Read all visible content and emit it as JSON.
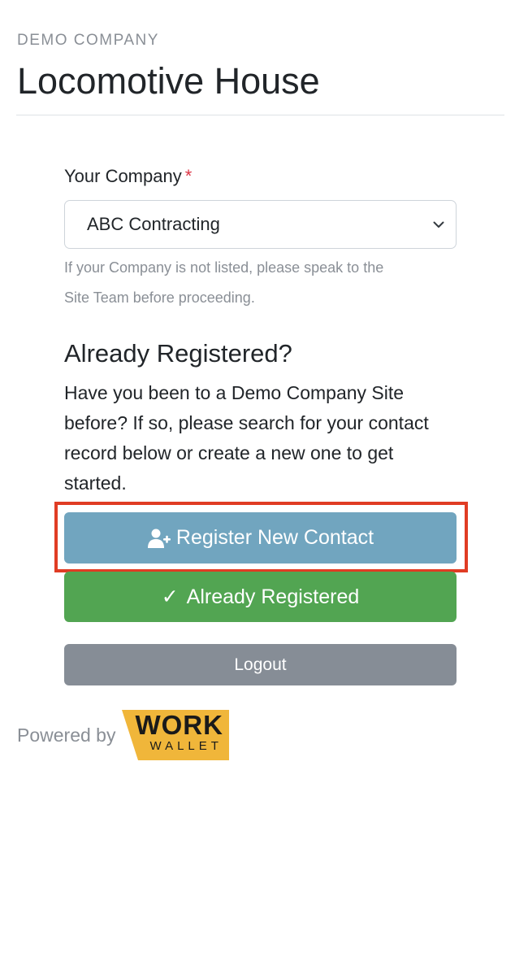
{
  "header": {
    "company": "DEMO COMPANY",
    "site_title": "Locomotive House"
  },
  "form": {
    "company_label": "Your Company",
    "required_mark": "*",
    "company_selected": "ABC Contracting",
    "help_line1": "If your Company is not listed, please speak to the",
    "help_line2": "Site Team before proceeding.",
    "section_heading": "Already Registered?",
    "body_lines": [
      "Have you been to a Demo Company Site",
      "before? If so, please search for your contact",
      "record below or create a new one to get",
      "started."
    ]
  },
  "buttons": {
    "register_label": "Register New Contact",
    "already_label": "Already Registered",
    "already_check": "✓",
    "logout_label": "Logout"
  },
  "footer": {
    "powered_by": "Powered by",
    "logo_line1": "WORK",
    "logo_line2": "WALLET"
  },
  "icons": {
    "register": "user-plus-icon",
    "select": "chevron-down-icon"
  },
  "colors": {
    "register_button": "#71a5bf",
    "already_button": "#52a552",
    "logout_button": "#868d96",
    "highlight": "#e03c24",
    "logo_bg": "#f0b63a",
    "required": "#dc3545"
  }
}
